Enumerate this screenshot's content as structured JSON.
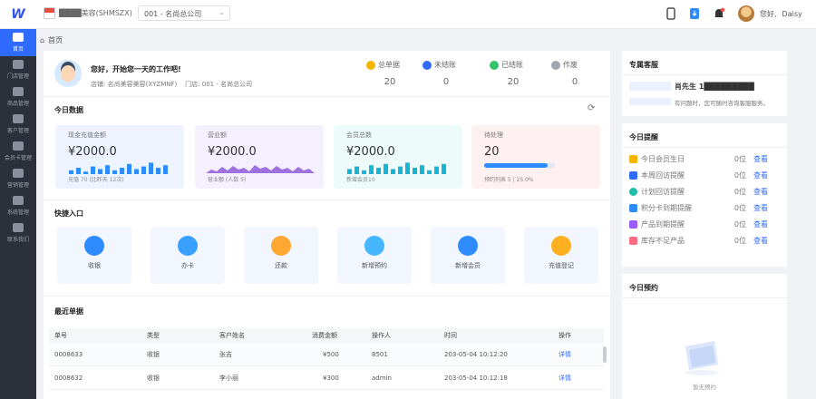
{
  "topbar": {
    "store_name": "████美容(SHMSZX)",
    "branch_select": "001 - 名尚总公司",
    "user_name": "Daisy",
    "greet": "您好,"
  },
  "sidebar": [
    "首页",
    "门店管理",
    "商品管理",
    "客户管理",
    "会员卡管理",
    "营销管理",
    "系统管理",
    "联系我们"
  ],
  "breadcrumb": "首页",
  "welcome": {
    "title": "您好，开始您一天的工作吧!",
    "shop_label": "店铺:",
    "shop": "名尚美容美容(XYZMNF)",
    "store_label": "门店:",
    "store": "001 - 名尚总公司"
  },
  "stats": [
    {
      "label": "总单据",
      "value": "20",
      "color": "#f5b400"
    },
    {
      "label": "未结账",
      "value": "0",
      "color": "#2f6bff"
    },
    {
      "label": "已结账",
      "value": "20",
      "color": "#35c46a"
    },
    {
      "label": "作废",
      "value": "0",
      "color": "#a0a6b2"
    }
  ],
  "today": {
    "title": "今日数据"
  },
  "cards": [
    {
      "title": "现金充值金额",
      "value": "¥2000.0",
      "sub": "充值 70 (比昨天 12次)",
      "bg": "#eef4ff",
      "bars": [
        0.3,
        0.5,
        0.2,
        0.6,
        0.4,
        0.7,
        0.3,
        0.5,
        0.8,
        0.4,
        0.6,
        0.9,
        0.5,
        0.7
      ]
    },
    {
      "title": "营业额",
      "value": "¥2000.0",
      "sub": "营业额 (人数 5)",
      "bg": "#f4f0ff"
    },
    {
      "title": "会员总数",
      "value": "¥2000.0",
      "sub": "新增会员10",
      "bg": "#eefbfb",
      "bars": [
        0.4,
        0.6,
        0.3,
        0.7,
        0.5,
        0.8,
        0.4,
        0.6,
        0.9,
        0.5,
        0.7,
        0.3,
        0.6,
        0.8
      ]
    },
    {
      "title": "待处理",
      "value": "20",
      "sub": "预约列表 5 | 25.0%",
      "bg": "#fff1f1",
      "progress": 0.9
    }
  ],
  "quick": {
    "title": "快捷入口",
    "items": [
      {
        "label": "收银",
        "color": "#2f8cff"
      },
      {
        "label": "办卡",
        "color": "#3aa0ff"
      },
      {
        "label": "还款",
        "color": "#ffa733"
      },
      {
        "label": "新增预约",
        "color": "#45b6ff"
      },
      {
        "label": "新增会员",
        "color": "#2f8cff"
      },
      {
        "label": "充值登记",
        "color": "#ffb020"
      }
    ]
  },
  "recent": {
    "title": "最近单据",
    "headers": [
      "单号",
      "类型",
      "客户姓名",
      "消费金额",
      "操作人",
      "时间",
      "操作"
    ],
    "rows": [
      [
        "0008633",
        "收银",
        "张吉",
        "¥500",
        "8501",
        "203-05-04 10:12:20",
        "详情"
      ],
      [
        "0008632",
        "收银",
        "李小丽",
        "¥300",
        "admin",
        "203-05-04 10:12:18",
        "详情"
      ]
    ]
  },
  "service": {
    "title": "专属客服",
    "name": "肖先生 1█████████",
    "desc": "有问题时，您可随时咨询客服服务。"
  },
  "reminders": {
    "title": "今日提醒",
    "unit": "查看",
    "items": [
      {
        "label": "今日会员生日",
        "count": "0位",
        "color": "#f5b400"
      },
      {
        "label": "本周回访提醒",
        "count": "0位",
        "color": "#2f6bff"
      },
      {
        "label": "计划回访提醒",
        "count": "0位",
        "color": "#1fbfa8"
      },
      {
        "label": "积分卡到期提醒",
        "count": "0位",
        "color": "#2f8cff"
      },
      {
        "label": "产品到期提醒",
        "count": "0位",
        "color": "#9b59ff"
      },
      {
        "label": "库存不足产品",
        "count": "0位",
        "color": "#ff6b81"
      }
    ]
  },
  "appointments": {
    "title": "今日预约",
    "empty": "暂无预约"
  }
}
